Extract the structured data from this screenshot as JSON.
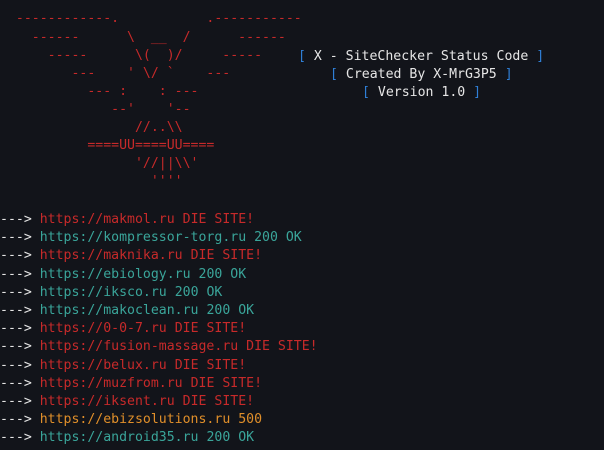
{
  "banner": {
    "ascii_art": [
      "  ------------.           .-----------",
      "    ------      \\  __  /      ------",
      "      -----      \\(  )/     -----",
      "         ---    ' \\/ `    ---",
      "           --- :    : ---",
      "              --'    '--",
      "                 //..\\\\",
      "           ====UU====UU====",
      "                 '//||\\\\'",
      "                   ''''"
    ],
    "info": [
      {
        "open": "[",
        "text": " X - SiteChecker Status Code ",
        "close": "]"
      },
      {
        "open": "[",
        "text": " Created By X-MrG3P5 ",
        "close": "]"
      },
      {
        "open": "[",
        "text": " Version 1.0 ",
        "close": "]"
      }
    ]
  },
  "results": [
    {
      "arrow": "---> ",
      "url": "https://makmol.ru",
      "status": "DIE SITE!",
      "state": "dead"
    },
    {
      "arrow": "---> ",
      "url": "https://kompressor-torg.ru",
      "status": "200 OK",
      "state": "ok"
    },
    {
      "arrow": "---> ",
      "url": "https://maknika.ru",
      "status": "DIE SITE!",
      "state": "dead"
    },
    {
      "arrow": "---> ",
      "url": "https://ebiology.ru",
      "status": "200 OK",
      "state": "ok"
    },
    {
      "arrow": "---> ",
      "url": "https://iksco.ru",
      "status": "200 OK",
      "state": "ok"
    },
    {
      "arrow": "---> ",
      "url": "https://makoclean.ru",
      "status": "200 OK",
      "state": "ok"
    },
    {
      "arrow": "---> ",
      "url": "https://0-0-7.ru",
      "status": "DIE SITE!",
      "state": "dead"
    },
    {
      "arrow": "---> ",
      "url": "https://fusion-massage.ru",
      "status": "DIE SITE!",
      "state": "dead"
    },
    {
      "arrow": "---> ",
      "url": "https://belux.ru",
      "status": "DIE SITE!",
      "state": "dead"
    },
    {
      "arrow": "---> ",
      "url": "https://muzfrom.ru",
      "status": "DIE SITE!",
      "state": "dead"
    },
    {
      "arrow": "---> ",
      "url": "https://iksent.ru",
      "status": "DIE SITE!",
      "state": "dead"
    },
    {
      "arrow": "---> ",
      "url": "https://ebizsolutions.ru",
      "status": "500",
      "state": "warn"
    },
    {
      "arrow": "---> ",
      "url": "https://android35.ru",
      "status": "200 OK",
      "state": "ok"
    }
  ],
  "colors": {
    "background": "#12141a",
    "dead": "#c72a2a",
    "ok": "#3aa59a",
    "warn": "#e08f2a",
    "bracket": "#2f7fd6",
    "text": "#e6e6e6"
  }
}
